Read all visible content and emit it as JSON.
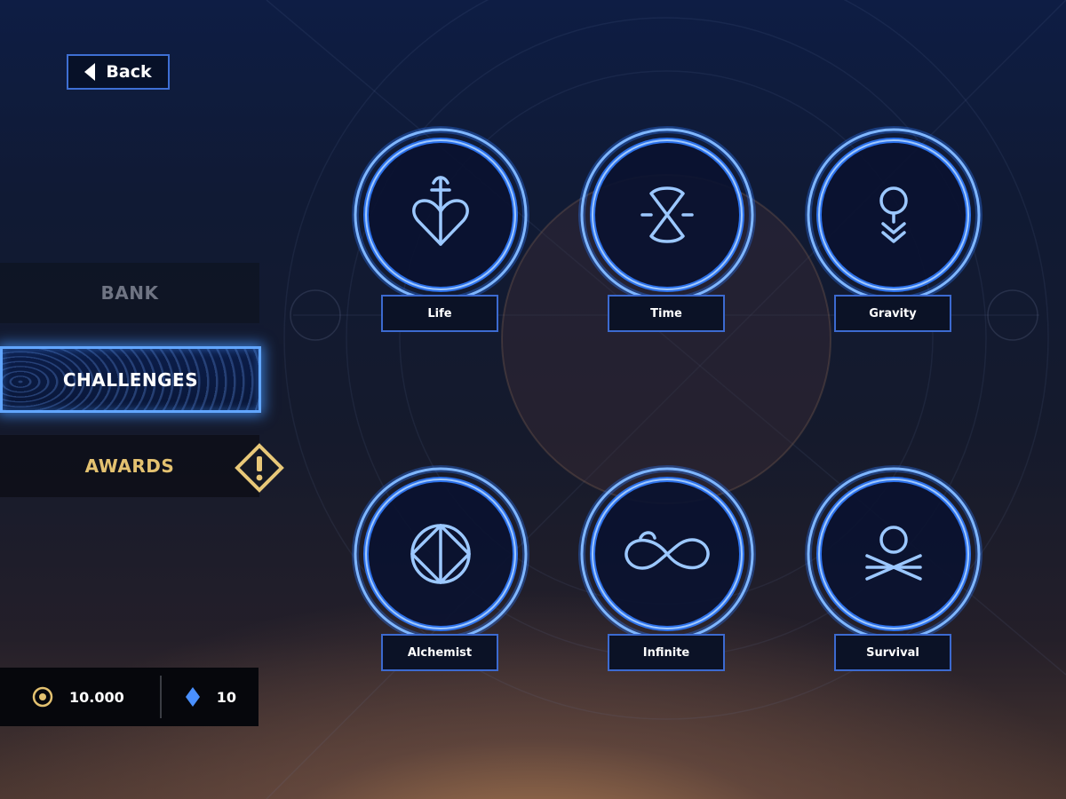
{
  "header": {
    "back_label": "Back"
  },
  "menu": {
    "items": [
      {
        "label": "BANK",
        "state": "inactive"
      },
      {
        "label": "CHALLENGES",
        "state": "selected"
      },
      {
        "label": "AWARDS",
        "state": "alert"
      }
    ]
  },
  "currency": {
    "coins": "10.000",
    "gems": "10"
  },
  "challenges": [
    {
      "name": "Life",
      "icon": "heart-anchor-icon"
    },
    {
      "name": "Time",
      "icon": "hourglass-icon"
    },
    {
      "name": "Gravity",
      "icon": "gravity-drop-icon"
    },
    {
      "name": "Alchemist",
      "icon": "diamond-circle-icon"
    },
    {
      "name": "Infinite",
      "icon": "infinity-icon"
    },
    {
      "name": "Survival",
      "icon": "crossbones-icon"
    }
  ],
  "colors": {
    "accent_blue": "#4a90ff",
    "awards_gold": "#e3c170",
    "badge_gold": "#e8c878",
    "tile_glow": "#2f7bff"
  }
}
